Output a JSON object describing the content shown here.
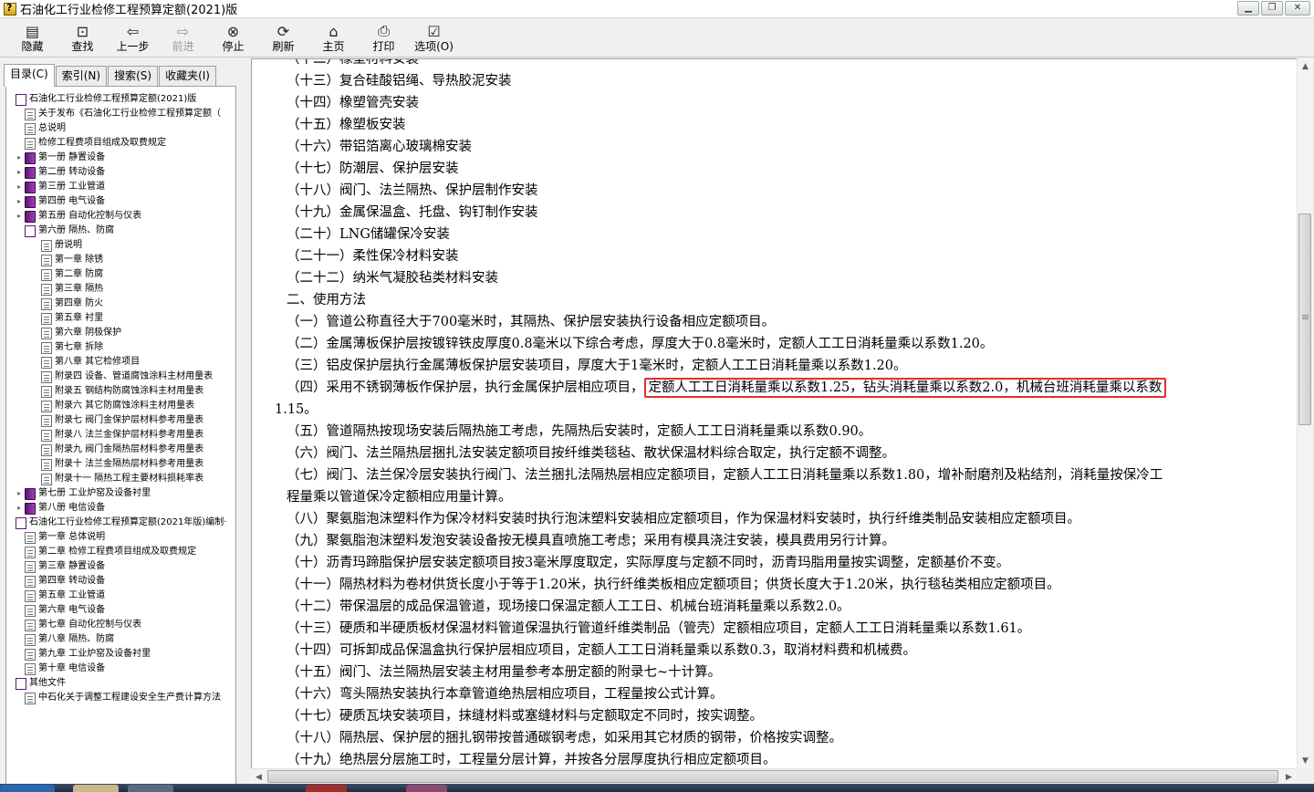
{
  "window": {
    "title": "石油化工行业检修工程预算定额(2021)版"
  },
  "toolbar": {
    "buttons": [
      {
        "label": "隐藏",
        "icon": "hide-icon"
      },
      {
        "label": "查找",
        "icon": "find-icon"
      },
      {
        "label": "上一步",
        "icon": "back-icon"
      },
      {
        "label": "前进",
        "icon": "forward-icon",
        "disabled": true
      },
      {
        "label": "停止",
        "icon": "stop-icon"
      },
      {
        "label": "刷新",
        "icon": "refresh-icon"
      },
      {
        "label": "主页",
        "icon": "home-icon"
      },
      {
        "label": "打印",
        "icon": "print-icon"
      },
      {
        "label": "选项(O)",
        "icon": "options-icon"
      }
    ]
  },
  "tabs": [
    "目录(C)",
    "索引(N)",
    "搜索(S)",
    "收藏夹(I)"
  ],
  "tree": [
    {
      "label": "石油化工行业检修工程预算定额(2021)版",
      "icon": "book-open",
      "level": 0
    },
    {
      "label": "关于发布《石油化工行业检修工程预算定额（",
      "icon": "page",
      "level": 1
    },
    {
      "label": "总说明",
      "icon": "page",
      "level": 1
    },
    {
      "label": "检修工程费项目组成及取费规定",
      "icon": "page",
      "level": 1
    },
    {
      "label": "第一册  静置设备",
      "icon": "book",
      "level": 1
    },
    {
      "label": "第二册  转动设备",
      "icon": "book",
      "level": 1
    },
    {
      "label": "第三册  工业管道",
      "icon": "book",
      "level": 1
    },
    {
      "label": "第四册  电气设备",
      "icon": "book",
      "level": 1
    },
    {
      "label": "第五册  自动化控制与仪表",
      "icon": "book",
      "level": 1
    },
    {
      "label": "第六册  隔热、防腐",
      "icon": "book-open",
      "level": 1
    },
    {
      "label": "册说明",
      "icon": "page",
      "level": 2
    },
    {
      "label": "第一章  除锈",
      "icon": "page",
      "level": 2
    },
    {
      "label": "第二章  防腐",
      "icon": "page",
      "level": 2
    },
    {
      "label": "第三章  隔热",
      "icon": "page",
      "level": 2
    },
    {
      "label": "第四章  防火",
      "icon": "page",
      "level": 2
    },
    {
      "label": "第五章  衬里",
      "icon": "page",
      "level": 2
    },
    {
      "label": "第六章  阴极保护",
      "icon": "page",
      "level": 2
    },
    {
      "label": "第七章  拆除",
      "icon": "page",
      "level": 2
    },
    {
      "label": "第八章  其它检修项目",
      "icon": "page",
      "level": 2
    },
    {
      "label": "附录四  设备、管道腐蚀涂料主材用量表",
      "icon": "page",
      "level": 2
    },
    {
      "label": "附录五  钢结构防腐蚀涂料主材用量表",
      "icon": "page",
      "level": 2
    },
    {
      "label": "附录六  其它防腐蚀涂料主材用量表",
      "icon": "page",
      "level": 2
    },
    {
      "label": "附录七  阀门金保护层材料参考用量表",
      "icon": "page",
      "level": 2
    },
    {
      "label": "附录八  法兰金保护层材料参考用量表",
      "icon": "page",
      "level": 2
    },
    {
      "label": "附录九  阀门金隔热层材料参考用量表",
      "icon": "page",
      "level": 2
    },
    {
      "label": "附录十  法兰金隔热层材料参考用量表",
      "icon": "page",
      "level": 2
    },
    {
      "label": "附录十一  隔热工程主要材料损耗率表",
      "icon": "page",
      "level": 2
    },
    {
      "label": "第七册  工业炉窑及设备衬里",
      "icon": "book",
      "level": 1
    },
    {
      "label": "第八册  电信设备",
      "icon": "book",
      "level": 1
    },
    {
      "label": "石油化工行业检修工程预算定额(2021年版)编制·",
      "icon": "book-open",
      "level": 0
    },
    {
      "label": "第一章  总体说明",
      "icon": "page",
      "level": 1
    },
    {
      "label": "第二章  检修工程费项目组成及取费规定",
      "icon": "page",
      "level": 1
    },
    {
      "label": "第三章  静置设备",
      "icon": "page",
      "level": 1
    },
    {
      "label": "第四章  转动设备",
      "icon": "page",
      "level": 1
    },
    {
      "label": "第五章  工业管道",
      "icon": "page",
      "level": 1
    },
    {
      "label": "第六章  电气设备",
      "icon": "page",
      "level": 1
    },
    {
      "label": "第七章  自动化控制与仪表",
      "icon": "page",
      "level": 1
    },
    {
      "label": "第八章  隔热、防腐",
      "icon": "page",
      "level": 1
    },
    {
      "label": "第九章  工业炉窑及设备衬里",
      "icon": "page",
      "level": 1
    },
    {
      "label": "第十章  电信设备",
      "icon": "page",
      "level": 1
    },
    {
      "label": "其他文件",
      "icon": "book-open",
      "level": 0
    },
    {
      "label": "中石化关于调整工程建设安全生产费计算方法",
      "icon": "page",
      "level": 1
    }
  ],
  "content": {
    "lines": [
      {
        "text": "（十二）橡塑材料安装"
      },
      {
        "text": "（十三）复合硅酸铝绳、导热胶泥安装"
      },
      {
        "text": "（十四）橡塑管壳安装"
      },
      {
        "text": "（十五）橡塑板安装"
      },
      {
        "text": "（十六）带铝箔离心玻璃棉安装"
      },
      {
        "text": "（十七）防潮层、保护层安装"
      },
      {
        "text": "（十八）阀门、法兰隔热、保护层制作安装"
      },
      {
        "text": "（十九）金属保温盒、托盘、钩钉制作安装"
      },
      {
        "text": "（二十）LNG储罐保冷安装"
      },
      {
        "text": "（二十一）柔性保冷材料安装"
      },
      {
        "text": "（二十二）纳米气凝胶毡类材料安装"
      },
      {
        "text": "二、使用方法"
      },
      {
        "text": "（一）管道公称直径大于700毫米时，其隔热、保护层安装执行设备相应定额项目。"
      },
      {
        "text": "（二）金属薄板保护层按镀锌铁皮厚度0.8毫米以下综合考虑，厚度大于0.8毫米时，定额人工工日消耗量乘以系数1.20。"
      },
      {
        "text": "（三）铝皮保护层执行金属薄板保护层安装项目，厚度大于1毫米时，定额人工工日消耗量乘以系数1.20。"
      },
      {
        "text": "（四）采用不锈钢薄板作保护层，执行金属保护层相应项目，",
        "highlight": "定额人工工日消耗量乘以系数1.25，钻头消耗量乘以系数2.0，机械台班消耗量乘以系数"
      },
      {
        "text": "1.15。"
      },
      {
        "text": "（五）管道隔热按现场安装后隔热施工考虑，先隔热后安装时，定额人工工日消耗量乘以系数0.90。"
      },
      {
        "text": "（六）阀门、法兰隔热层捆扎法安装定额项目按纤维类毯毡、散状保温材料综合取定，执行定额不调整。"
      },
      {
        "text": "（七）阀门、法兰保冷层安装执行阀门、法兰捆扎法隔热层相应定额项目，定额人工工日消耗量乘以系数1.80，增补耐磨剂及粘结剂，消耗量按保冷工"
      },
      {
        "text": "程量乘以管道保冷定额相应用量计算。"
      },
      {
        "text": "（八）聚氨脂泡沫塑料作为保冷材料安装时执行泡沫塑料安装相应定额项目，作为保温材料安装时，执行纤维类制品安装相应定额项目。"
      },
      {
        "text": "（九）聚氨脂泡沫塑料发泡安装设备按无模具直喷施工考虑；采用有模具浇注安装，模具费用另行计算。"
      },
      {
        "text": "（十）沥青玛蹄脂保护层安装定额项目按3毫米厚度取定，实际厚度与定额不同时，沥青玛脂用量按实调整，定额基价不变。"
      },
      {
        "text": "（十一）隔热材料为卷材供货长度小于等于1.20米，执行纤维类板相应定额项目；供货长度大于1.20米，执行毯毡类相应定额项目。"
      },
      {
        "text": "（十二）带保温层的成品保温管道，现场接口保温定额人工工日、机械台班消耗量乘以系数2.0。"
      },
      {
        "text": "（十三）硬质和半硬质板材保温材料管道保温执行管道纤维类制品（管壳）定额相应项目，定额人工工日消耗量乘以系数1.61。"
      },
      {
        "text": "（十四）可拆卸成品保温盒执行保护层相应项目，定额人工工日消耗量乘以系数0.3，取消材料费和机械费。"
      },
      {
        "text": "（十五）阀门、法兰隔热层安装主材用量参考本册定额的附录七~十计算。"
      },
      {
        "text": "（十六）弯头隔热安装执行本章管道绝热层相应项目，工程量按公式计算。"
      },
      {
        "text": "（十七）硬质瓦块安装项目，抹缝材料或塞缝材料与定额取定不同时，按实调整。"
      },
      {
        "text": "（十八）隔热层、保护层的捆扎钢带按普通碳钢考虑，如采用其它材质的钢带，价格按实调整。"
      },
      {
        "text": "（十九）绝热层分层施工时，工程量分层计算，并按各分层厚度执行相应定额项目。"
      }
    ]
  },
  "colors": {
    "highlight_border": "#e0302a"
  }
}
